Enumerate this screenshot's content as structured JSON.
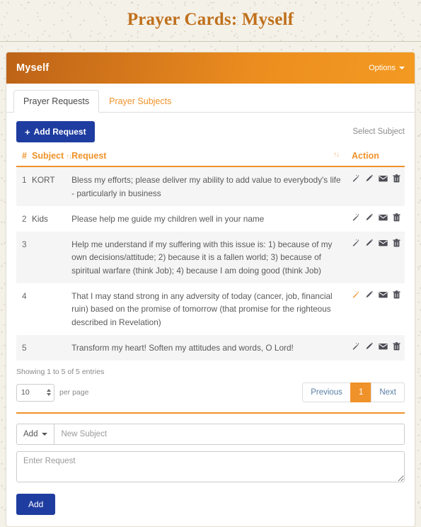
{
  "page": {
    "title": "Prayer Cards: Myself"
  },
  "card": {
    "header_title": "Myself",
    "options_label": "Options"
  },
  "tabs": [
    {
      "label": "Prayer Requests",
      "active": true
    },
    {
      "label": "Prayer Subjects",
      "active": false
    }
  ],
  "toolbar": {
    "add_request_label": "Add Request",
    "plus_glyph": "+",
    "select_subject_label": "Select Subject"
  },
  "table": {
    "columns": {
      "num": "#",
      "subject": "Subject",
      "request": "Request",
      "action": "Action"
    },
    "sort_glyph": "↑↓",
    "rows": [
      {
        "num": "1",
        "subject": "KORT",
        "request": "Bless my efforts; please deliver my ability to add value to everybody's life - particularly in business",
        "wand_active": false
      },
      {
        "num": "2",
        "subject": "Kids",
        "request": "Please help me guide my children well in your name",
        "wand_active": false
      },
      {
        "num": "3",
        "subject": "",
        "request": "Help me understand if my suffering with this issue is: 1) because of my own decisions/attitude; 2) because it is a fallen world; 3) because of spiritual warfare (think Job); 4) because I am doing good (think Job)",
        "wand_active": false
      },
      {
        "num": "4",
        "subject": "",
        "request": "That I may stand strong in any adversity of today (cancer, job, financial ruin) based on the promise of tomorrow (that promise for the righteous described in Revelation)",
        "wand_active": true
      },
      {
        "num": "5",
        "subject": "",
        "request": "Transform my heart! Soften my attitudes and words, O Lord!",
        "wand_active": false
      }
    ],
    "action_icons": [
      "magic-wand-icon",
      "pencil-icon",
      "envelope-icon",
      "trash-icon"
    ]
  },
  "footer": {
    "showing_entries": "Showing 1 to 5 of 5 entries",
    "per_page_value": "10",
    "per_page_label": "per page",
    "pagination": {
      "previous": "Previous",
      "pages": [
        "1"
      ],
      "active_page": "1",
      "next": "Next"
    }
  },
  "add_form": {
    "add_dropdown_label": "Add",
    "new_subject_placeholder": "New Subject",
    "new_subject_value": "",
    "request_placeholder": "Enter Request",
    "request_value": "",
    "submit_label": "Add"
  },
  "colors": {
    "accent_orange": "#f0922a",
    "header_gradient_start": "#bd6317",
    "header_gradient_end": "#f39a22",
    "title_brown": "#c0701c",
    "primary_blue": "#1f3da0",
    "page_background": "#f4f1e8",
    "stripe_gray": "#f5f5f5",
    "icon_gray": "#4c4c55"
  }
}
